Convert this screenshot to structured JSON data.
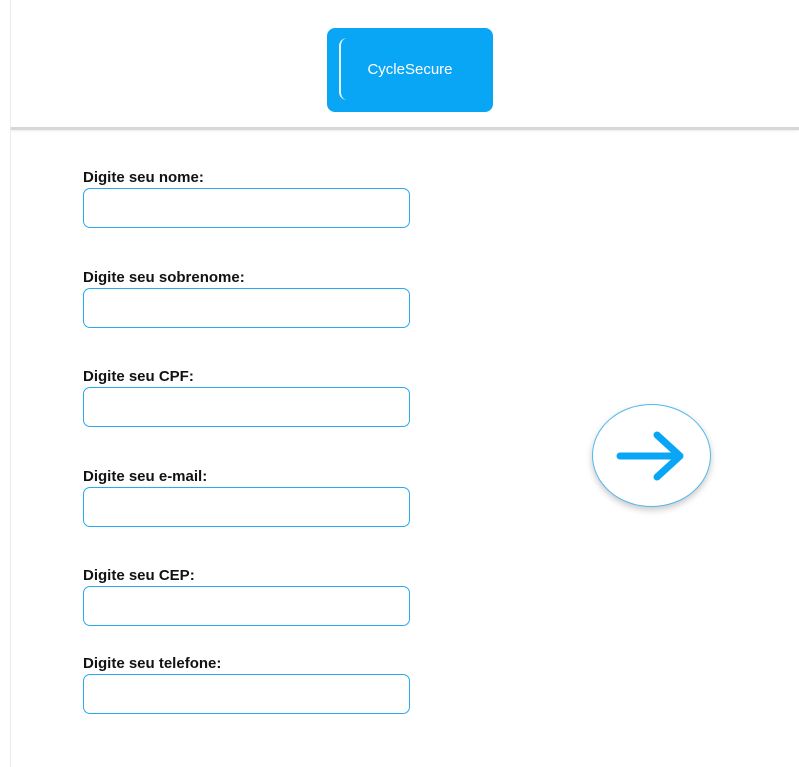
{
  "header": {
    "logo_text": "CycleSecure"
  },
  "form": {
    "fields": [
      {
        "label": "Digite seu nome:",
        "value": "",
        "placeholder": ""
      },
      {
        "label": "Digite seu sobrenome:",
        "value": "",
        "placeholder": ""
      },
      {
        "label": "Digite seu CPF:",
        "value": "",
        "placeholder": ""
      },
      {
        "label": "Digite seu e-mail:",
        "value": "",
        "placeholder": ""
      },
      {
        "label": "Digite seu CEP:",
        "value": "",
        "placeholder": ""
      },
      {
        "label": "Digite seu telefone:",
        "value": "",
        "placeholder": ""
      }
    ]
  },
  "next_button": {
    "icon": "arrow-right-icon"
  },
  "colors": {
    "brand": "#0aa6f6",
    "input_border": "#29a9ee",
    "arrow": "#0aa6f6",
    "label_text": "#121212"
  }
}
